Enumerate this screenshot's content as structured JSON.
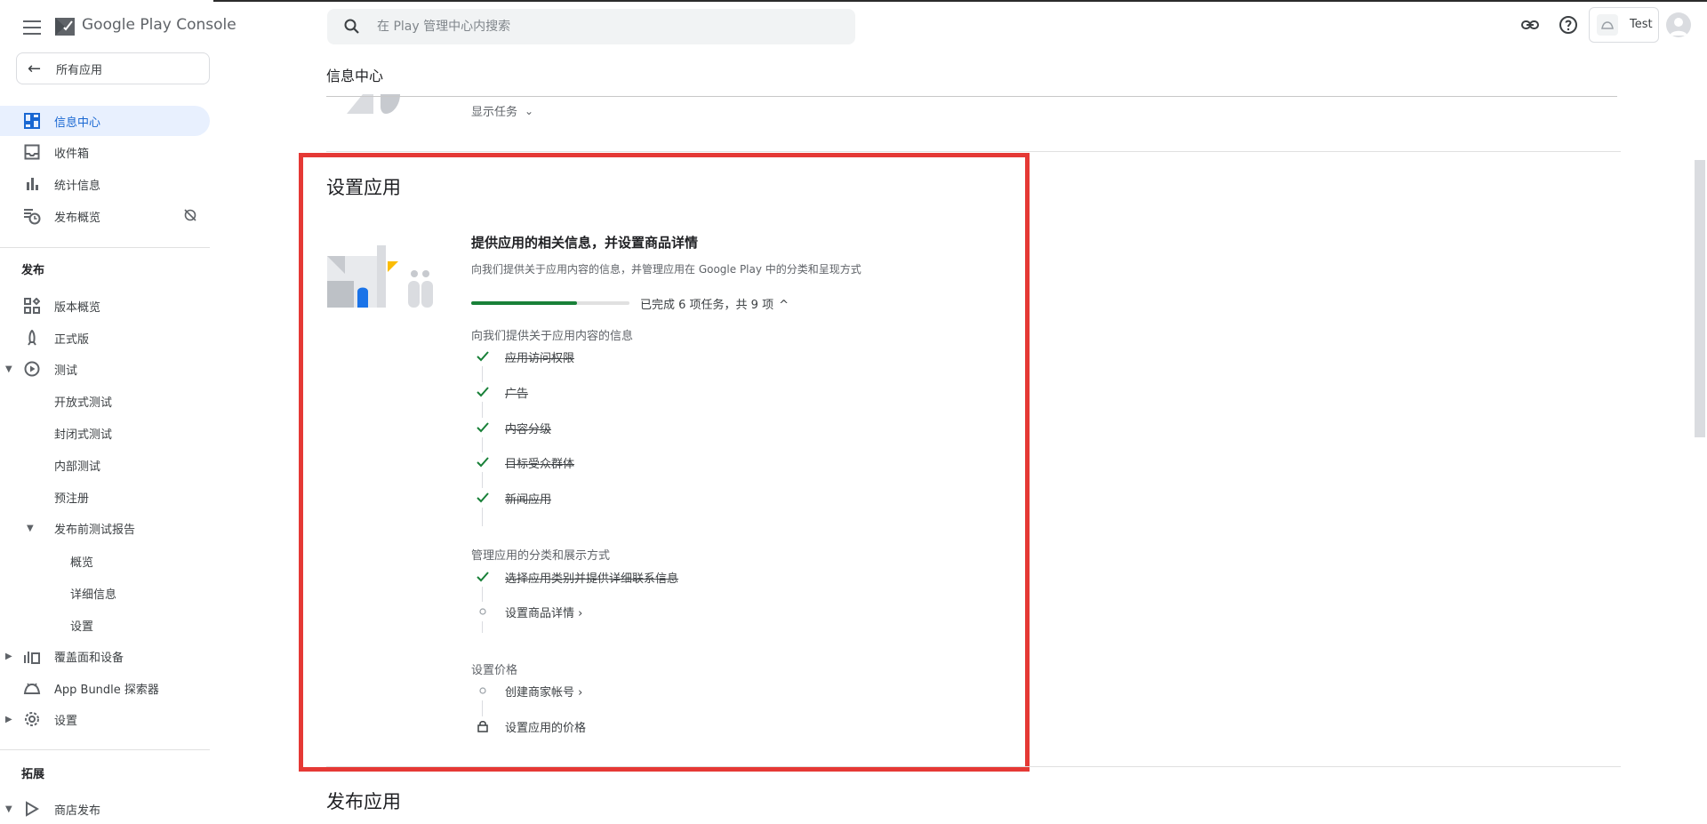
{
  "app": {
    "brand": "Google Play Console"
  },
  "sidebar": {
    "back_label": "所有应用",
    "items_top": [
      {
        "label": "信息中心",
        "icon": "dashboard-icon",
        "active": true
      },
      {
        "label": "收件箱",
        "icon": "inbox-icon"
      },
      {
        "label": "统计信息",
        "icon": "bar-chart-icon"
      },
      {
        "label": "发布概览",
        "icon": "publishing-overview-icon",
        "badge_icon": "sync-off-icon"
      }
    ],
    "section_release": "发布",
    "items_release": [
      {
        "label": "版本概览",
        "icon": "releases-overview-icon"
      },
      {
        "label": "正式版",
        "icon": "production-icon"
      },
      {
        "label": "测试",
        "icon": "play-circle-icon",
        "expanded": true
      },
      {
        "label": "开放式测试"
      },
      {
        "label": "封闭式测试"
      },
      {
        "label": "内部测试"
      },
      {
        "label": "预注册"
      },
      {
        "label": "发布前测试报告",
        "expanded": true
      },
      {
        "label": "概览"
      },
      {
        "label": "详细信息"
      },
      {
        "label": "设置"
      },
      {
        "label": "覆盖面和设备",
        "icon": "reach-devices-icon",
        "collapsed": true
      },
      {
        "label": "App Bundle 探索器",
        "icon": "app-bundle-icon"
      },
      {
        "label": "设置",
        "icon": "gear-icon",
        "collapsed": true
      }
    ],
    "section_grow": "拓展",
    "items_grow": [
      {
        "label": "商店发布",
        "icon": "store-presence-icon",
        "expanded": true
      }
    ]
  },
  "topbar": {
    "search_placeholder": "在 Play 管理中心内搜索",
    "account_name": "Test"
  },
  "page": {
    "title": "信息中心",
    "show_tasks": "显示任务"
  },
  "setup_card": {
    "title": "设置应用",
    "heading": "提供应用的相关信息，并设置商品详情",
    "description": "向我们提供关于应用内容的信息，并管理应用在 Google Play 中的分类和呈现方式",
    "progress_text": "已完成 6 项任务，共 9 项",
    "progress_fraction": 0.6667,
    "groups": [
      {
        "label": "向我们提供关于应用内容的信息",
        "tasks": [
          {
            "label": "应用访问权限",
            "status": "done"
          },
          {
            "label": "广告",
            "status": "done"
          },
          {
            "label": "内容分级",
            "status": "done"
          },
          {
            "label": "目标受众群体",
            "status": "done"
          },
          {
            "label": "新闻应用",
            "status": "done"
          }
        ]
      },
      {
        "label": "管理应用的分类和展示方式",
        "tasks": [
          {
            "label": "选择应用类别并提供详细联系信息",
            "status": "done"
          },
          {
            "label": "设置商品详情",
            "status": "todo"
          }
        ]
      },
      {
        "label": "设置价格",
        "tasks": [
          {
            "label": "创建商家帐号",
            "status": "todo"
          },
          {
            "label": "设置应用的价格",
            "status": "locked"
          }
        ]
      }
    ]
  },
  "next_card": {
    "title": "发布应用"
  },
  "colors": {
    "accent": "#1967d2",
    "active_bg": "#e8f0fe",
    "success": "#188038",
    "highlight": "#e53935"
  }
}
